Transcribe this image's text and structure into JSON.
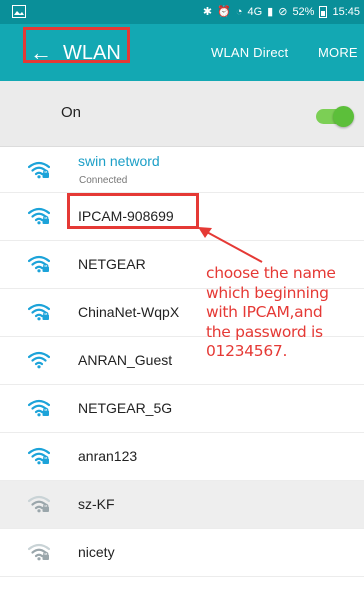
{
  "status_bar": {
    "network_type": "4G",
    "battery": "52%",
    "time": "15:45",
    "background": "#0a8f99"
  },
  "app_bar": {
    "back_icon": "arrow-left-icon",
    "title": "WLAN",
    "actions": [
      "WLAN Direct",
      "MORE"
    ],
    "background": "#13a8b3"
  },
  "wlan_toggle": {
    "label": "On",
    "state": "on",
    "accent": "#5cbf3a"
  },
  "networks": [
    {
      "name": "swin netword",
      "status": "Connected",
      "secured": true,
      "signal": 3
    },
    {
      "name": "IPCAM-908699",
      "secured": true,
      "signal": 3
    },
    {
      "name": "NETGEAR",
      "secured": true,
      "signal": 3
    },
    {
      "name": "ChinaNet-WqpX",
      "secured": true,
      "signal": 3
    },
    {
      "name": "ANRAN_Guest",
      "secured": false,
      "signal": 3
    },
    {
      "name": "NETGEAR_5G",
      "secured": true,
      "signal": 3
    },
    {
      "name": "anran123",
      "secured": true,
      "signal": 3
    },
    {
      "name": "sz-KF",
      "secured": true,
      "signal": 2
    },
    {
      "name": "nicety",
      "secured": true,
      "signal": 2
    }
  ],
  "annotation": {
    "lines": [
      "choose the name",
      "which beginning",
      "with IPCAM,and",
      "the password is",
      "01234567."
    ],
    "color": "#e53935"
  }
}
